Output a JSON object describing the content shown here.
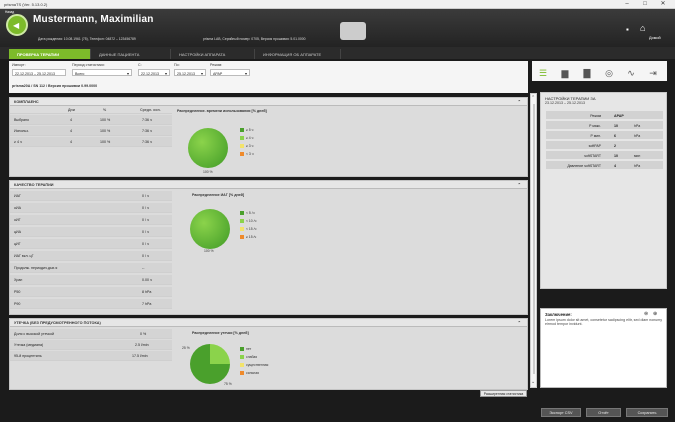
{
  "window": {
    "title": "prismaTS (Ver. 5.13.0.2)",
    "min": "–",
    "max": "□",
    "close": "✕"
  },
  "header": {
    "back_label": "Назад",
    "patient_name_1": "Mustermann, Maximilian",
    "patient_name_2": "",
    "patient_info": "Дата рождения: 10.08.1961 (75), Телефон: 04872 – 123456789",
    "device_info": "prisma LAB, Серийный номер: 0705, Версия прошивки: 5.01.0000",
    "home_label": "Домой"
  },
  "tabs": [
    {
      "label": "ПРОВЕРКА ТЕРАПИИ"
    },
    {
      "label": "ДАННЫЕ ПАЦИЕНТА"
    },
    {
      "label": "НАСТРОЙКИ АППАРАТА"
    },
    {
      "label": "ИНФОРМАЦИЯ ОБ АППАРАТЕ"
    }
  ],
  "filters": {
    "import_label": "Импорт:",
    "import_value": "22.12.2013 – 25.12.2013",
    "period_label": "Период статистики:",
    "period_value": "Всего",
    "from_label": "С:",
    "from_value": "22.12.2013",
    "to_label": "По:",
    "to_value": "25.12.2013",
    "mode_label": "Режим:",
    "mode_value": "APAP",
    "device_line": "prisma20A / SN 112 / Версия прошивки 0.99.0000"
  },
  "compliance": {
    "title": "КОМПЛАЕНС",
    "headers": [
      "Дни",
      "%",
      "Средн. исп."
    ],
    "rows": [
      {
        "label": "Выбрано",
        "days": "4",
        "pct": "100 %",
        "avg": "7:36 ч"
      },
      {
        "label": "Использ.",
        "days": "4",
        "pct": "100 %",
        "avg": "7:36 ч"
      },
      {
        "label": "≥ 4 ч",
        "days": "4",
        "pct": "100 %",
        "avg": "7:36 ч"
      }
    ],
    "chart_title": "Распределение. времени использования [% дней]",
    "pie_label": "100 %",
    "legend": [
      "≥ 5 ч",
      "≥ 4 ч",
      "≥ 3 ч",
      "< 3 ч"
    ]
  },
  "quality": {
    "title": "КАЧЕСТВО ТЕРАПИИ",
    "rows": [
      {
        "label": "ИАГ",
        "val": "0 / ч"
      },
      {
        "label": "oИА",
        "val": "0 / ч"
      },
      {
        "label": "oИГ",
        "val": "0 / ч"
      },
      {
        "label": "цИА",
        "val": "0 / ч"
      },
      {
        "label": "цИГ",
        "val": "0 / ч"
      },
      {
        "label": "ИАГ вкл. цГ",
        "val": "0 / ч"
      },
      {
        "label": "Продолж. периодич.дых.я",
        "val": "--"
      },
      {
        "label": "Храп",
        "val": "0.00 ч"
      },
      {
        "label": "P50",
        "val": "8 hPa"
      },
      {
        "label": "P90",
        "val": "7 hPa"
      }
    ],
    "chart_title": "Распределение ИАГ [% дней]",
    "pie_label": "100 %",
    "legend": [
      "< 5 /ч",
      "< 10 /ч",
      "< 15 /ч",
      "≥ 15 /ч"
    ]
  },
  "leakage": {
    "title": "УТЕЧКА (без предусмотренного потока)",
    "rows": [
      {
        "label": "Доля с высокой утечкой",
        "val": "0 %"
      },
      {
        "label": "Утечка (медиана)",
        "val": "2.5 l/min"
      },
      {
        "label": "95-й процентиль",
        "val": "17.5 l/min"
      }
    ],
    "chart_title": "Распределение утечки [% дней]",
    "pie_label_a": "25 %",
    "pie_label_b": "75 %",
    "legend": [
      "нет",
      "слабая",
      "существенная",
      "сильная"
    ]
  },
  "extended_stats_button": "Расширенная статистика",
  "summary": {
    "title": "НАСТРОЙКИ ТЕРАПИИ ЗА",
    "date": "23.12.2013 – 25.12.2013",
    "rows": [
      {
        "label": "Режим",
        "val": "APAP",
        "unit": ""
      },
      {
        "label": "P макс.",
        "val": "10",
        "unit": "hPa"
      },
      {
        "label": "P мин.",
        "val": "6",
        "unit": "hPa"
      },
      {
        "label": "softPAP",
        "val": "2",
        "unit": ""
      },
      {
        "label": "softSTART",
        "val": "10",
        "unit": "мин"
      },
      {
        "label": "Давление softSTART",
        "val": "4",
        "unit": "hPa"
      }
    ]
  },
  "conclusion": {
    "title": "Заключение:",
    "text": "Lorem ipsum dolor sit amet, consetetur sadipscing elitr, sed diam nonumy eirmod tempor invidunt."
  },
  "bottom": {
    "export": "Экспорт CSV",
    "report": "Отчёт",
    "save": "Сохранить"
  },
  "colors": {
    "accent": "#7dbb2a",
    "green_dark": "#4aa02c",
    "green_light": "#8bd34b",
    "yellow": "#f3e36b",
    "orange": "#ef8a2b"
  }
}
